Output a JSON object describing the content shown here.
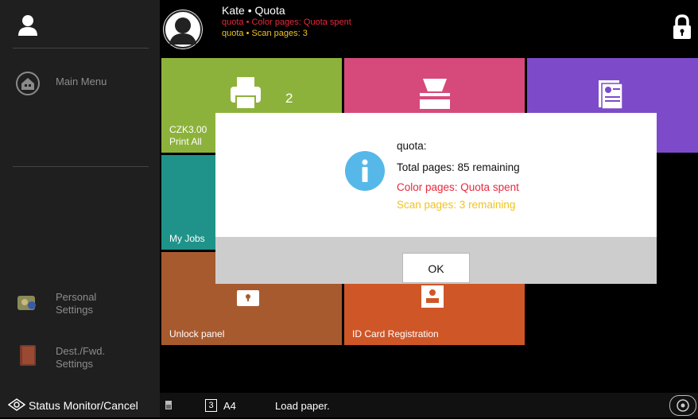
{
  "sidebar": {
    "main_menu": "Main Menu",
    "personal_settings": "Personal\nSettings",
    "dest_fwd_settings": "Dest./Fwd.\nSettings"
  },
  "header": {
    "user_title": "Kate • Quota",
    "line2": "quota • Color pages: Quota spent",
    "line3": "quota • Scan pages: 3",
    "colors": {
      "warn": "#e8283c",
      "caution": "#f0c31e"
    }
  },
  "tiles": {
    "print": {
      "count": "2",
      "label": "CZK3.00\nPrint All",
      "color": "#8db23b"
    },
    "scan": {
      "color": "#d64a7b"
    },
    "doc": {
      "color": "#7d4bc9"
    },
    "jobs": {
      "label": "My Jobs",
      "color": "#1f9389"
    },
    "unlock": {
      "label": "Unlock panel",
      "color": "#a85a2f"
    },
    "idcard": {
      "label": "ID Card Registration",
      "color": "#cf5627"
    }
  },
  "dialog": {
    "title": "quota:",
    "total": "Total pages: 85 remaining",
    "color": "Color pages: Quota spent",
    "scan": "Scan pages: 3 remaining",
    "ok": "OK"
  },
  "statusbar": {
    "monitor": "Status Monitor/Cancel",
    "tray": "3",
    "paper": "A4",
    "message": "Load paper."
  }
}
